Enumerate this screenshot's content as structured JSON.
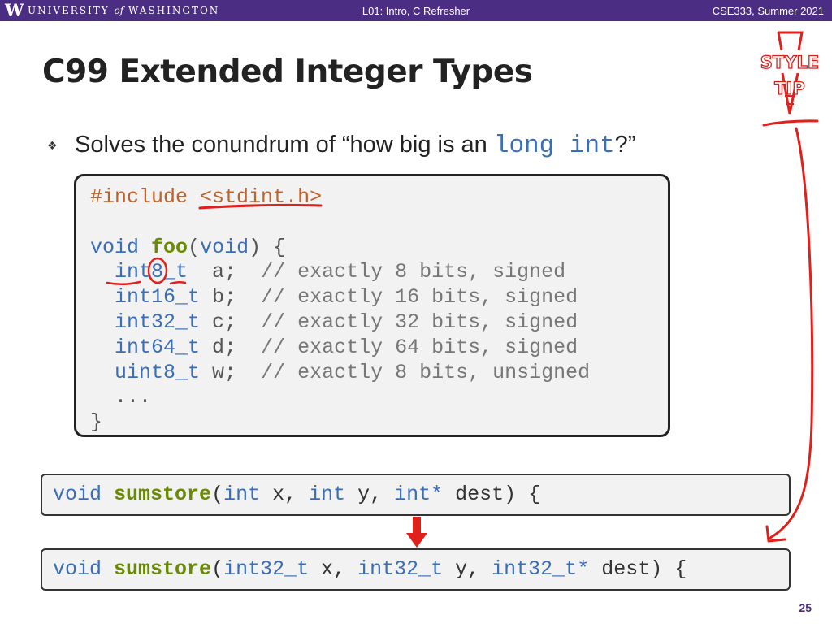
{
  "header": {
    "logo_letter": "W",
    "university_prefix": "UNIVERSITY",
    "university_of": "of",
    "university_suffix": "WASHINGTON",
    "lecture": "L01:  Intro, C Refresher",
    "course": "CSE333, Summer 2021"
  },
  "slide": {
    "title": "C99 Extended Integer Types",
    "bullet_mark": "❖",
    "bullet_prefix": "Solves the conundrum of “how big is an ",
    "bullet_code": "long int",
    "bullet_suffix": "?”",
    "page_number": "25"
  },
  "stamp": {
    "line1": "STYLE",
    "line2": "TIP"
  },
  "code": {
    "include_kw": "#include",
    "include_header": "<stdint.h>",
    "ret_type": "void",
    "fn_name": "foo",
    "param": "void",
    "open": ") {",
    "lines": [
      {
        "type": "int8_t",
        "var": "  a;",
        "comment": "// exactly 8 bits, signed"
      },
      {
        "type": "int16_t",
        "var": " b;",
        "comment": "// exactly 16 bits, signed"
      },
      {
        "type": "int32_t",
        "var": " c;",
        "comment": "// exactly 32 bits, signed"
      },
      {
        "type": "int64_t",
        "var": " d;",
        "comment": "// exactly 64 bits, signed"
      },
      {
        "type": "uint8_t",
        "var": " w;",
        "comment": "// exactly 8 bits, unsigned"
      }
    ],
    "ellipsis": "...",
    "close": "}"
  },
  "sig1": {
    "void": "void",
    "name": "sumstore",
    "t1": "int",
    "a1": " x, ",
    "t2": "int",
    "a2": " y, ",
    "t3": "int*",
    "a3": " dest) {"
  },
  "sig2": {
    "void": "void",
    "name": "sumstore",
    "t1": "int32_t",
    "a1": " x, ",
    "t2": "int32_t",
    "a2": " y, ",
    "t3": "int32_t*",
    "a3": " dest) {"
  },
  "colors": {
    "header_bg": "#4b2e83",
    "keyword": "#3a6fb8",
    "function": "#6a8a00",
    "preprocessor": "#c0622a",
    "annotation": "#e0201b"
  }
}
